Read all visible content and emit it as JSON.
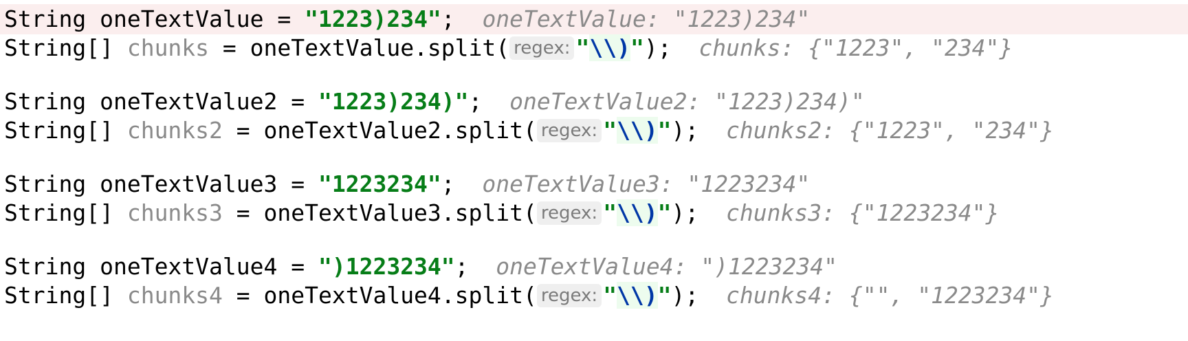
{
  "lines": [
    {
      "type": "decl",
      "decl_type": "String",
      "name": "oneTextValue",
      "op": " = ",
      "value": "\"1223)234\"",
      "end": ";",
      "hint": "oneTextValue: \"1223)234\""
    },
    {
      "type": "split",
      "decl_type": "String[]",
      "name": "chunks",
      "op": " = ",
      "receiver": "oneTextValue.split(",
      "param_label": "regex:",
      "arg_open": "\"",
      "arg_escape": "\\\\)",
      "arg_close": "\"",
      "end": ");",
      "hint": "chunks: {\"1223\", \"234\"}"
    },
    {
      "type": "decl",
      "decl_type": "String",
      "name": "oneTextValue2",
      "op": " = ",
      "value": "\"1223)234)\"",
      "end": ";",
      "hint": "oneTextValue2: \"1223)234)\""
    },
    {
      "type": "split",
      "decl_type": "String[]",
      "name": "chunks2",
      "op": " = ",
      "receiver": "oneTextValue2.split(",
      "param_label": "regex:",
      "arg_open": "\"",
      "arg_escape": "\\\\)",
      "arg_close": "\"",
      "end": ");",
      "hint": "chunks2: {\"1223\", \"234\"}"
    },
    {
      "type": "decl",
      "decl_type": "String",
      "name": "oneTextValue3",
      "op": " = ",
      "value": "\"1223234\"",
      "end": ";",
      "hint": "oneTextValue3: \"1223234\""
    },
    {
      "type": "split",
      "decl_type": "String[]",
      "name": "chunks3",
      "op": " = ",
      "receiver": "oneTextValue3.split(",
      "param_label": "regex:",
      "arg_open": "\"",
      "arg_escape": "\\\\)",
      "arg_close": "\"",
      "end": ");",
      "hint": "chunks3: {\"1223234\"}"
    },
    {
      "type": "decl",
      "decl_type": "String",
      "name": "oneTextValue4",
      "op": " = ",
      "value": "\")1223234\"",
      "end": ";",
      "hint": "oneTextValue4: \")1223234\""
    },
    {
      "type": "split",
      "decl_type": "String[]",
      "name": "chunks4",
      "op": " = ",
      "receiver": "oneTextValue4.split(",
      "param_label": "regex:",
      "arg_open": "\"",
      "arg_escape": "\\\\)",
      "arg_close": "\"",
      "end": ");",
      "hint": "chunks4: {\"\", \"1223234\"}"
    }
  ],
  "colors": {
    "string": "#067d17",
    "escape": "#0037a6",
    "hint": "#8a8a8a",
    "current_line": "#fbeeee"
  }
}
